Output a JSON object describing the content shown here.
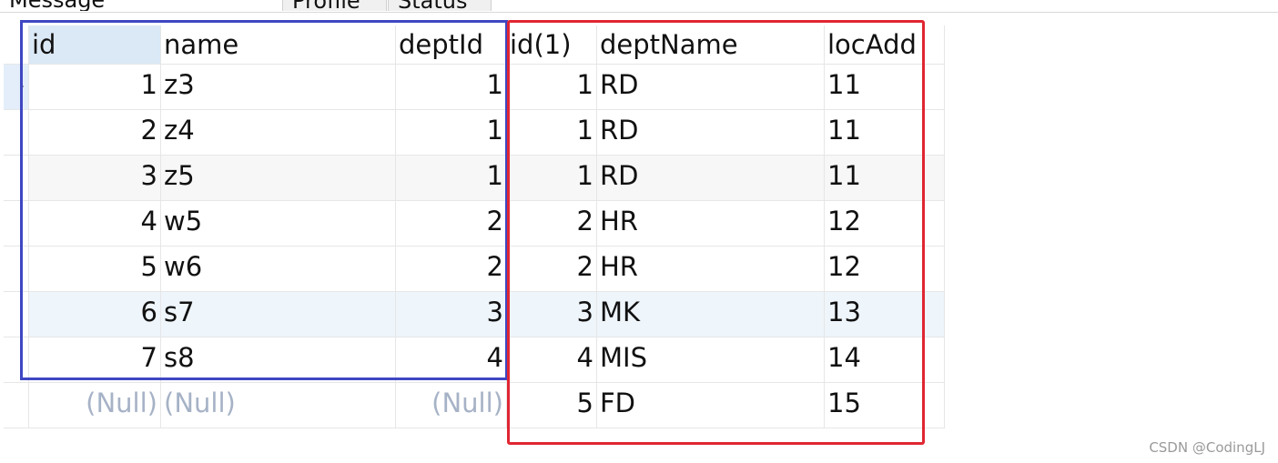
{
  "tabs": [
    {
      "label": "Message"
    },
    {
      "label": "Profile"
    },
    {
      "label": "Status"
    }
  ],
  "grid": {
    "columns": [
      "id",
      "name",
      "deptId",
      "id(1)",
      "deptName",
      "locAdd"
    ],
    "rows": [
      [
        "1",
        "z3",
        "1",
        "1",
        "RD",
        "11"
      ],
      [
        "2",
        "z4",
        "1",
        "1",
        "RD",
        "11"
      ],
      [
        "3",
        "z5",
        "1",
        "1",
        "RD",
        "11"
      ],
      [
        "4",
        "w5",
        "2",
        "2",
        "HR",
        "12"
      ],
      [
        "5",
        "w6",
        "2",
        "2",
        "HR",
        "12"
      ],
      [
        "6",
        "s7",
        "3",
        "3",
        "MK",
        "13"
      ],
      [
        "7",
        "s8",
        "4",
        "4",
        "MIS",
        "14"
      ],
      [
        "(Null)",
        "(Null)",
        "(Null)",
        "5",
        "FD",
        "15"
      ]
    ]
  },
  "watermark": "CSDN @CodingLJ",
  "colors": {
    "blue_box": "#3f47c2",
    "red_box": "#e02632",
    "header_active": "#dbe9f6",
    "null_text": "#a6b2c6"
  }
}
